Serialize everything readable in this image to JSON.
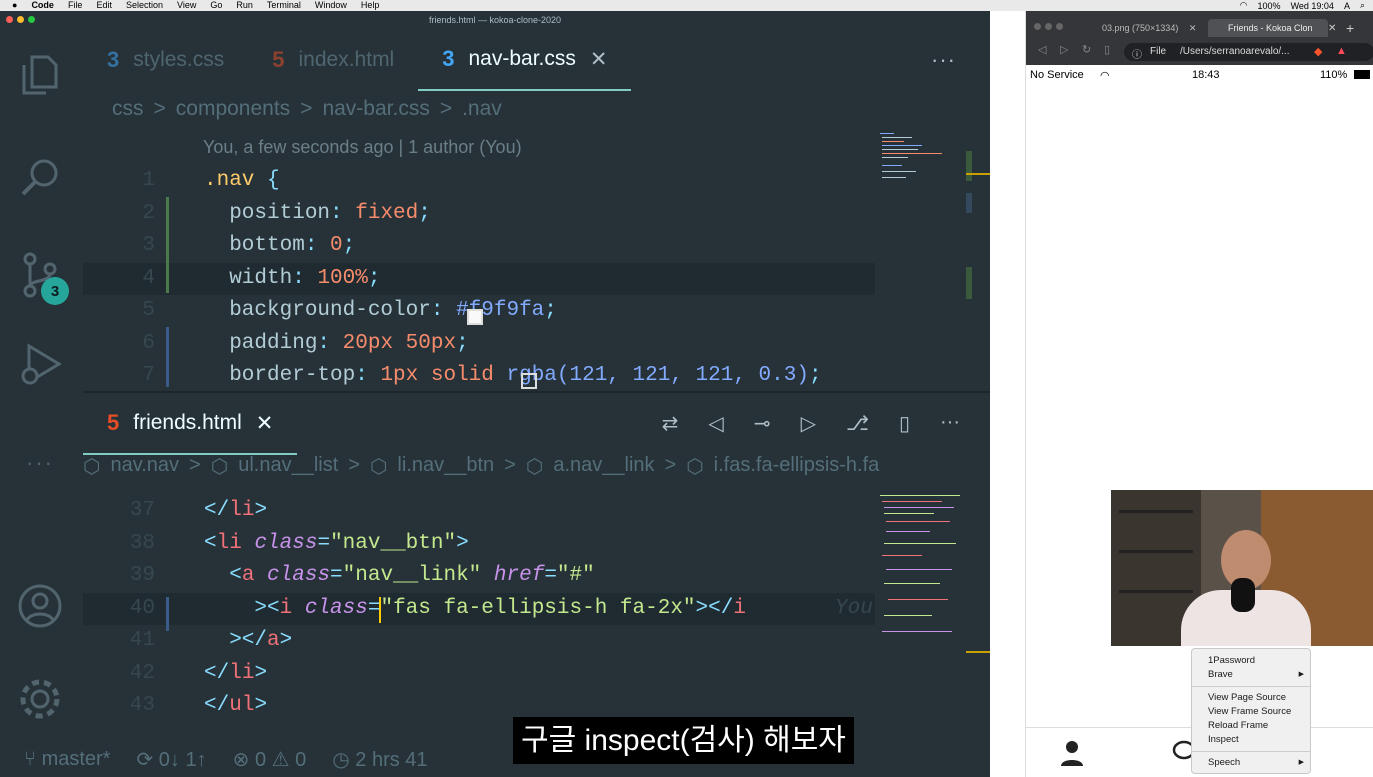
{
  "menubar": {
    "items": [
      "Code",
      "File",
      "Edit",
      "Selection",
      "View",
      "Go",
      "Run",
      "Terminal",
      "Window",
      "Help"
    ],
    "battery": "100%",
    "clock": "Wed 19:04",
    "input_indicator": "A"
  },
  "window_title": "friends.html — kokoa-clone-2020",
  "activity": {
    "scm_badge": "3"
  },
  "top_tabs": [
    {
      "icon": "css3-icon",
      "glyph": "3",
      "label": "styles.css",
      "color": "#42a5f5"
    },
    {
      "icon": "html5-icon",
      "glyph": "5",
      "label": "index.html",
      "color": "#e44d26"
    },
    {
      "icon": "css3-icon",
      "glyph": "3",
      "label": "nav-bar.css",
      "color": "#42a5f5"
    }
  ],
  "top_tab_close": "✕",
  "more_glyph": "···",
  "top_breadcrumb": [
    "css",
    "components",
    "nav-bar.css",
    ".nav"
  ],
  "breadcrumb_sep": ">",
  "blame": "You, a few seconds ago | 1 author (You)",
  "css_lines": [
    {
      "n": "1",
      "parts": [
        [
          ".nav",
          "sel"
        ],
        [
          " {",
          "pun"
        ]
      ]
    },
    {
      "n": "2",
      "parts": [
        [
          "  position",
          "prop"
        ],
        [
          ": ",
          "pun"
        ],
        [
          "fixed",
          "val"
        ],
        [
          ";",
          "pun"
        ]
      ]
    },
    {
      "n": "3",
      "parts": [
        [
          "  bottom",
          "prop"
        ],
        [
          ": ",
          "pun"
        ],
        [
          "0",
          "val"
        ],
        [
          ";",
          "pun"
        ]
      ]
    },
    {
      "n": "4",
      "parts": [
        [
          "  width",
          "prop"
        ],
        [
          ": ",
          "pun"
        ],
        [
          "100%",
          "val"
        ],
        [
          ";",
          "pun"
        ]
      ]
    },
    {
      "n": "5",
      "parts": [
        [
          "  background-color",
          "prop"
        ],
        [
          ": ",
          "pun"
        ],
        [
          "#f9f9fa",
          "hex"
        ],
        [
          ";",
          "pun"
        ]
      ]
    },
    {
      "n": "6",
      "parts": [
        [
          "  padding",
          "prop"
        ],
        [
          ": ",
          "pun"
        ],
        [
          "20px 50px",
          "val"
        ],
        [
          ";",
          "pun"
        ]
      ]
    },
    {
      "n": "7",
      "parts": [
        [
          "  border-top",
          "prop"
        ],
        [
          ": ",
          "pun"
        ],
        [
          "1px solid ",
          "val"
        ],
        [
          "rgba(121, 121, 121, 0.3)",
          "hex"
        ],
        [
          ";",
          "pun"
        ]
      ]
    }
  ],
  "bottom_tab": {
    "glyph": "5",
    "label": "friends.html",
    "close": "✕"
  },
  "bottom_breadcrumb": [
    "nav.nav",
    "ul.nav__list",
    "li.nav__btn",
    "a.nav__link",
    "i.fas.fa-ellipsis-h.fa"
  ],
  "html_lines": [
    {
      "n": "37",
      "parts": [
        [
          "</",
          "pun"
        ],
        [
          "li",
          "tag"
        ],
        [
          ">",
          "pun"
        ]
      ]
    },
    {
      "n": "38",
      "parts": [
        [
          "<",
          "pun"
        ],
        [
          "li",
          "tag"
        ],
        [
          " ",
          "txt"
        ],
        [
          "class",
          "attr"
        ],
        [
          "=",
          "pun"
        ],
        [
          "\"nav__btn\"",
          "str"
        ],
        [
          ">",
          "pun"
        ]
      ]
    },
    {
      "n": "39",
      "parts": [
        [
          "  <",
          "pun"
        ],
        [
          "a",
          "tag"
        ],
        [
          " ",
          "txt"
        ],
        [
          "class",
          "attr"
        ],
        [
          "=",
          "pun"
        ],
        [
          "\"nav__link\"",
          "str"
        ],
        [
          " ",
          "txt"
        ],
        [
          "href",
          "attr"
        ],
        [
          "=",
          "pun"
        ],
        [
          "\"#\"",
          "str"
        ]
      ]
    },
    {
      "n": "40",
      "parts": [
        [
          "    ><",
          "pun"
        ],
        [
          "i",
          "tag"
        ],
        [
          " ",
          "txt"
        ],
        [
          "class",
          "attr"
        ],
        [
          "=",
          "pun"
        ],
        [
          "\"fas fa-ellipsis-h fa-2x\"",
          "str"
        ],
        [
          "></",
          "pun"
        ],
        [
          "i",
          "tag"
        ]
      ]
    },
    {
      "n": "41",
      "parts": [
        [
          "  ></",
          "pun"
        ],
        [
          "a",
          "tag"
        ],
        [
          ">",
          "pun"
        ]
      ]
    },
    {
      "n": "42",
      "parts": [
        [
          "</",
          "pun"
        ],
        [
          "li",
          "tag"
        ],
        [
          ">",
          "pun"
        ]
      ]
    },
    {
      "n": "43",
      "parts": [
        [
          "</",
          "pun"
        ],
        [
          "ul",
          "tag"
        ],
        [
          ">",
          "pun"
        ]
      ]
    }
  ],
  "inline_blame": "You",
  "status": {
    "branch": "master*",
    "sync": "0↓ 1↑",
    "errors": "0",
    "warnings": "0",
    "time": "2 hrs 41"
  },
  "browser": {
    "tab1": "03.png (750×1334)",
    "tab2": "Friends - Kokoa Clon",
    "url_scheme": "File",
    "url": "/Users/serranoarevalo/...",
    "phone_carrier": "No Service",
    "phone_time": "18:43",
    "phone_battery": "110%"
  },
  "context_menu": {
    "group1": [
      "1Password",
      "Brave"
    ],
    "group2": [
      "View Page Source",
      "View Frame Source",
      "Reload Frame",
      "Inspect"
    ],
    "group3": [
      "Speech"
    ]
  },
  "subtitle": "구글 inspect(검사) 해보자"
}
